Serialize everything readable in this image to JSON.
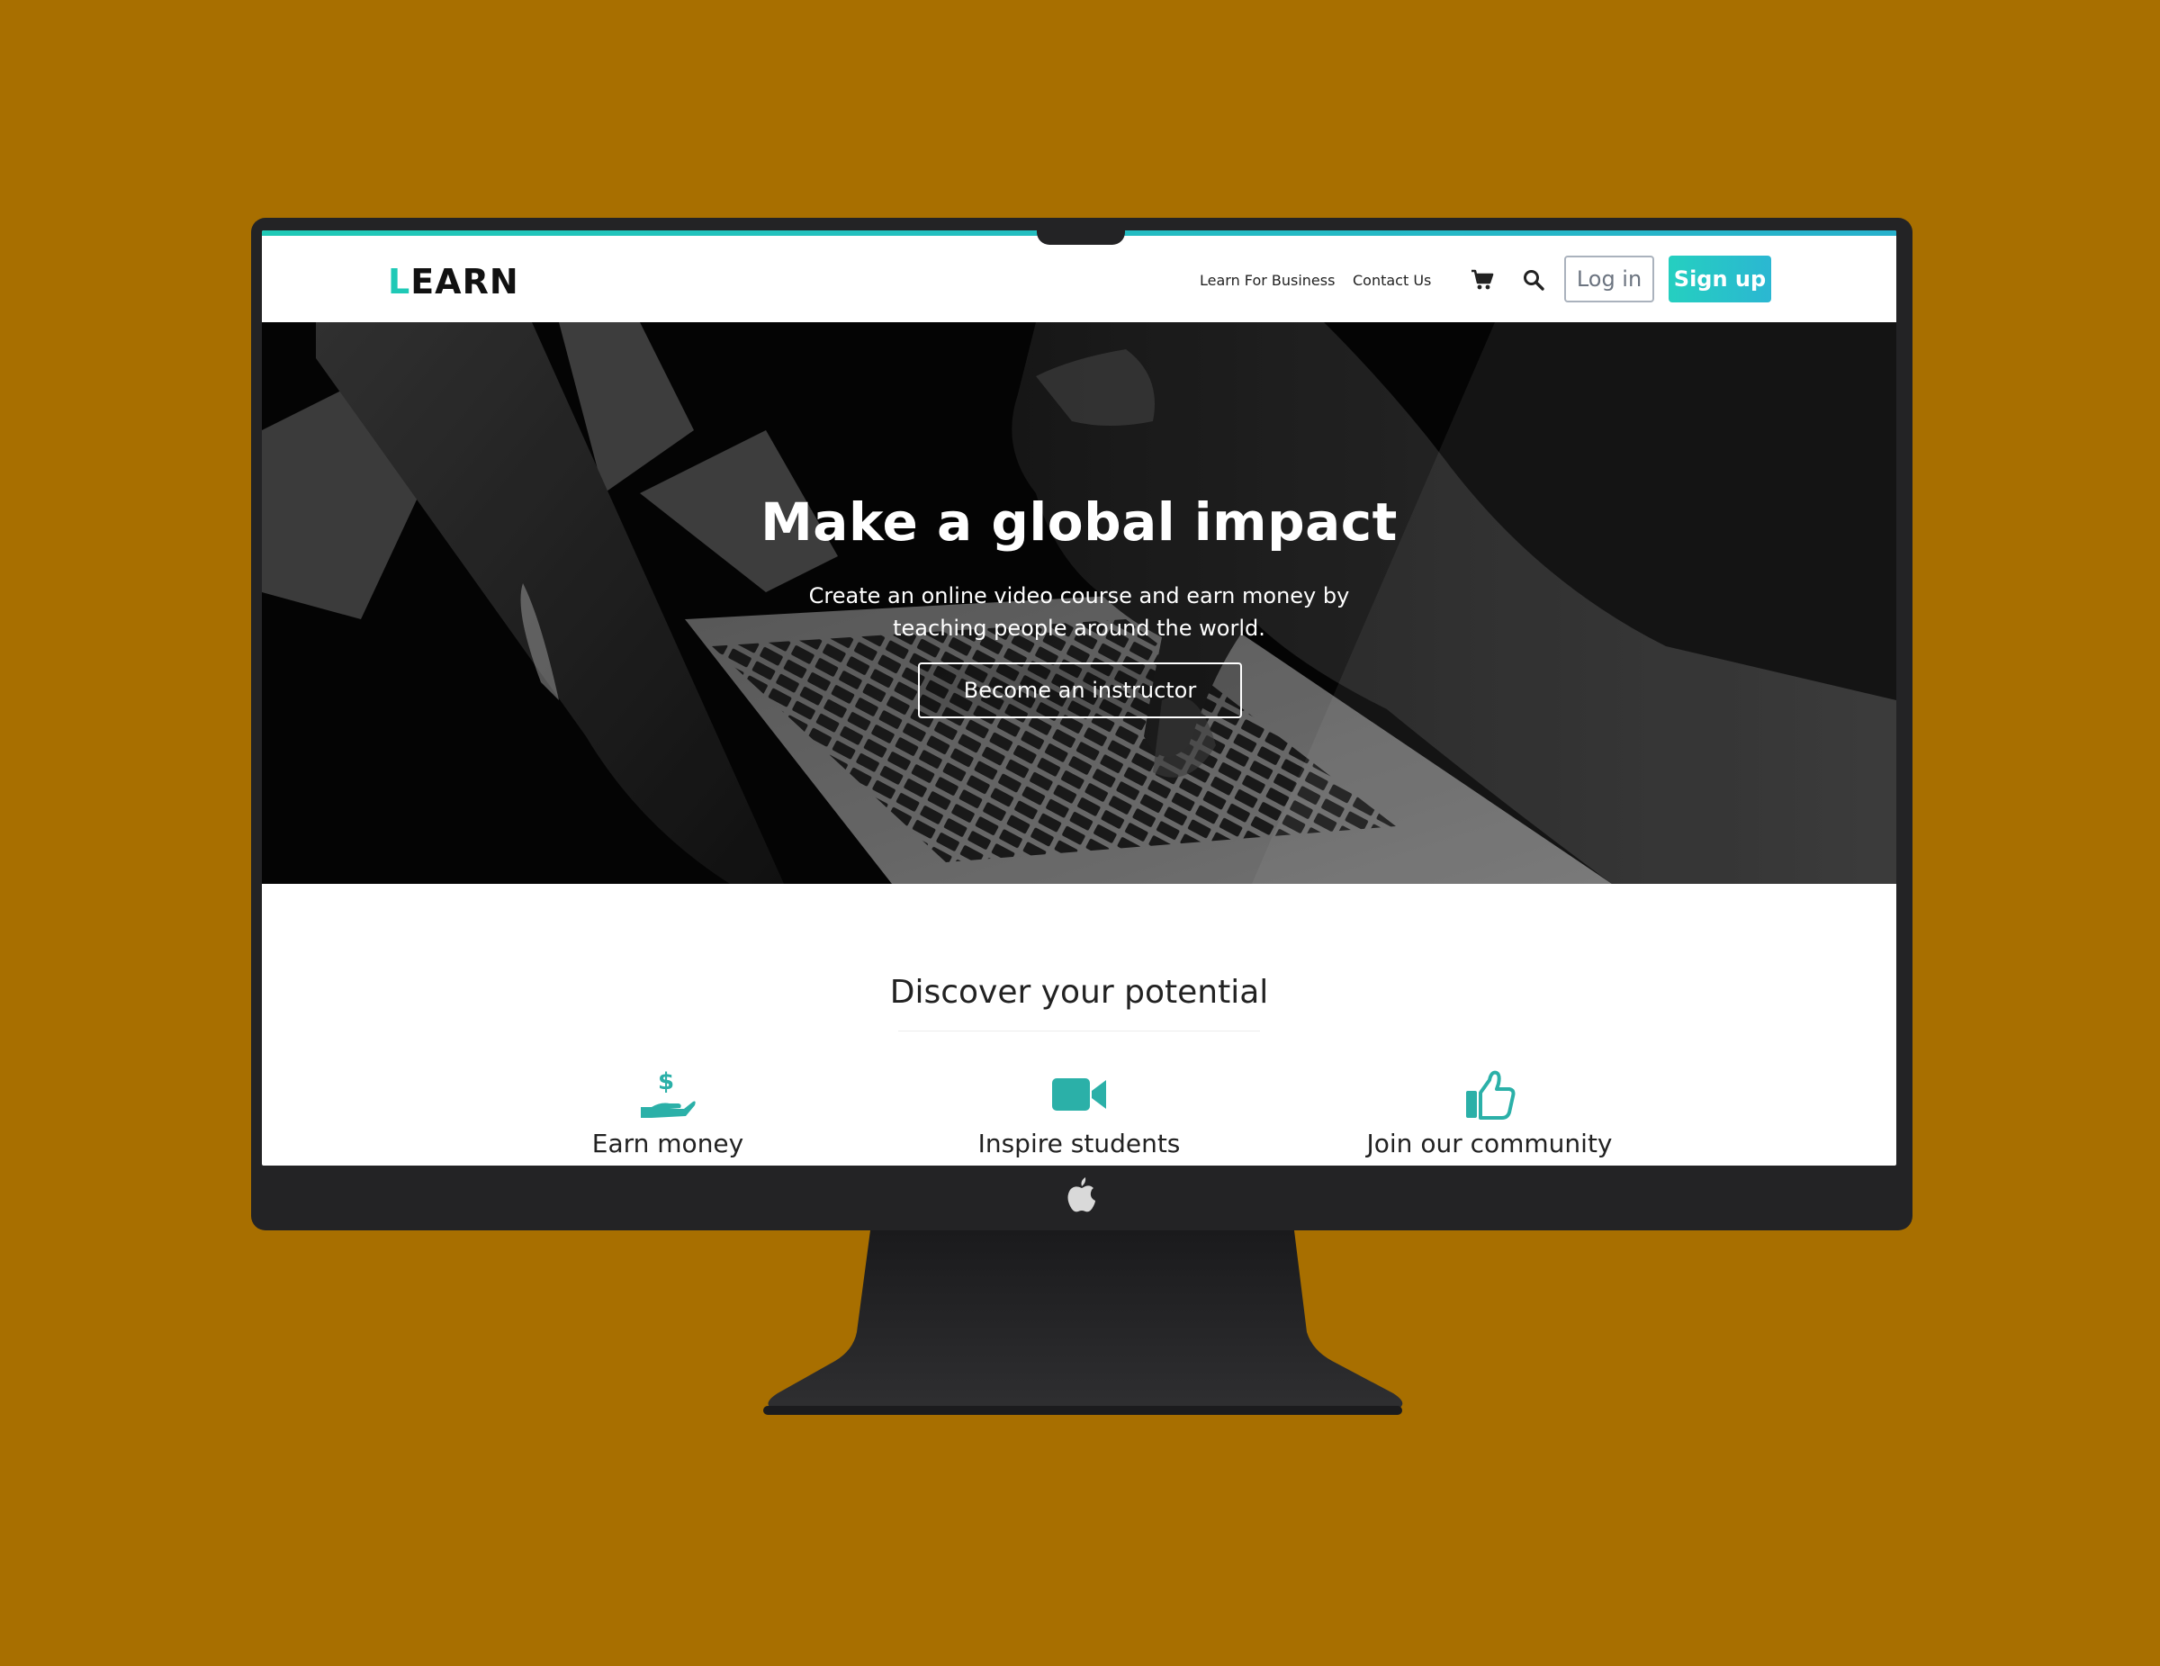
{
  "colors": {
    "background": "#a86f00",
    "accent": "#1fc9b6",
    "accent_blue": "#2bb7d2",
    "bezel": "#232325"
  },
  "nav": {
    "logo_first": "L",
    "logo_rest": "EARN",
    "links": [
      "Learn For Business",
      "Contact Us"
    ],
    "icons": [
      "cart-icon",
      "search-icon"
    ],
    "login_label": "Log in",
    "signup_label": "Sign up"
  },
  "hero": {
    "title": "Make a global impact",
    "subtitle_line1": "Create an online video course and earn money by",
    "subtitle_line2": "teaching people around the world.",
    "cta_label": "Become an instructor"
  },
  "section": {
    "title": "Discover your potential",
    "features": [
      {
        "icon": "hand-dollar-icon",
        "label": "Earn money"
      },
      {
        "icon": "video-camera-icon",
        "label": "Inspire students"
      },
      {
        "icon": "thumbs-up-icon",
        "label": "Join our community"
      }
    ]
  },
  "device": {
    "chin_icon": "apple-logo-icon"
  }
}
